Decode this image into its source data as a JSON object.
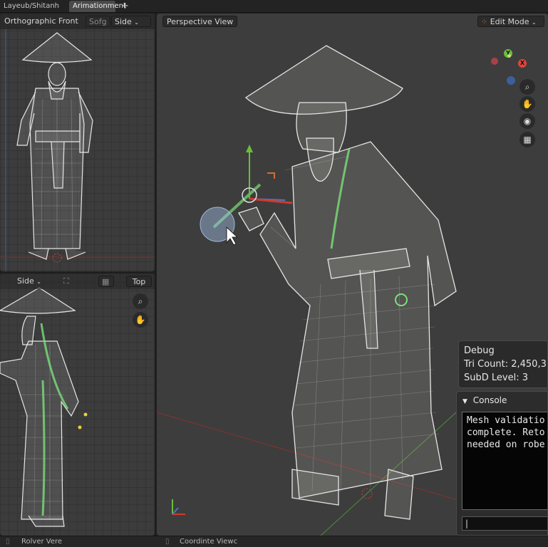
{
  "tabs": {
    "layout": "Layeub/Shitanh",
    "animation": "Arimationment",
    "add": "+"
  },
  "front_view": {
    "title": "Orthographic Front",
    "setting": "Sofg",
    "mode": "Side",
    "mode_icon": "chevron-down-icon"
  },
  "side_view": {
    "mode": "Side",
    "option": "Top",
    "icons": [
      "zoom-icon",
      "pan-hand-icon"
    ]
  },
  "persp_view": {
    "title": "Perspective View",
    "mode": "Edit Mode",
    "nav_icons": [
      "zoom-icon",
      "pan-hand-icon",
      "camera-icon",
      "grid-icon"
    ]
  },
  "gizmo": {
    "x_label": "X",
    "y_label": "Y",
    "colors": {
      "x": "#e0443a",
      "y": "#6bbd3a",
      "z": "#4a78c8"
    }
  },
  "debug": {
    "title": "Debug",
    "tri_count": "Tri Count: 2,450,3",
    "subd_level": "SubD Level: 3"
  },
  "console": {
    "title": "Console",
    "lines": [
      "Mesh validatio",
      "complete. Reto",
      "needed on robe"
    ],
    "input_value": ""
  },
  "status": {
    "left": "Rolver Vere",
    "right": "Coordinte Viewc"
  },
  "colors": {
    "panel": "#3c3c3c",
    "wire": "#e8e8e8",
    "accent_green": "#7be07a",
    "axis_red": "#c9302c"
  }
}
